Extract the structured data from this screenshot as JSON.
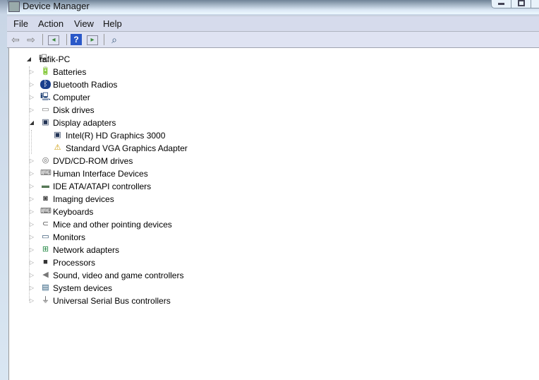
{
  "window": {
    "title": "Device Manager"
  },
  "menu": [
    "File",
    "Action",
    "View",
    "Help"
  ],
  "toolbar": [
    "back-icon",
    "forward-icon",
    "show-hide-console-tree-icon",
    "help-icon",
    "show-action-pane-icon",
    "scan-hardware-icon"
  ],
  "tree": {
    "root": "rafik-PC",
    "items": [
      {
        "label": "Batteries",
        "icon": "battery-icon"
      },
      {
        "label": "Bluetooth Radios",
        "icon": "bluetooth-icon"
      },
      {
        "label": "Computer",
        "icon": "computer-icon"
      },
      {
        "label": "Disk drives",
        "icon": "disk-drive-icon"
      },
      {
        "label": "Display adapters",
        "icon": "display-adapter-icon",
        "expanded": true,
        "children": [
          {
            "label": "Intel(R) HD Graphics 3000",
            "icon": "display-adapter-icon"
          },
          {
            "label": "Standard VGA Graphics Adapter",
            "icon": "warning-display-icon"
          }
        ]
      },
      {
        "label": "DVD/CD-ROM drives",
        "icon": "dvd-icon"
      },
      {
        "label": "Human Interface Devices",
        "icon": "hid-icon"
      },
      {
        "label": "IDE ATA/ATAPI controllers",
        "icon": "ide-icon"
      },
      {
        "label": "Imaging devices",
        "icon": "camera-icon"
      },
      {
        "label": "Keyboards",
        "icon": "keyboard-icon"
      },
      {
        "label": "Mice and other pointing devices",
        "icon": "mouse-icon"
      },
      {
        "label": "Monitors",
        "icon": "monitor-icon"
      },
      {
        "label": "Network adapters",
        "icon": "network-icon"
      },
      {
        "label": "Processors",
        "icon": "processor-icon"
      },
      {
        "label": "Sound, video and game controllers",
        "icon": "speaker-icon"
      },
      {
        "label": "System devices",
        "icon": "system-icon"
      },
      {
        "label": "Universal Serial Bus controllers",
        "icon": "usb-icon"
      }
    ]
  }
}
